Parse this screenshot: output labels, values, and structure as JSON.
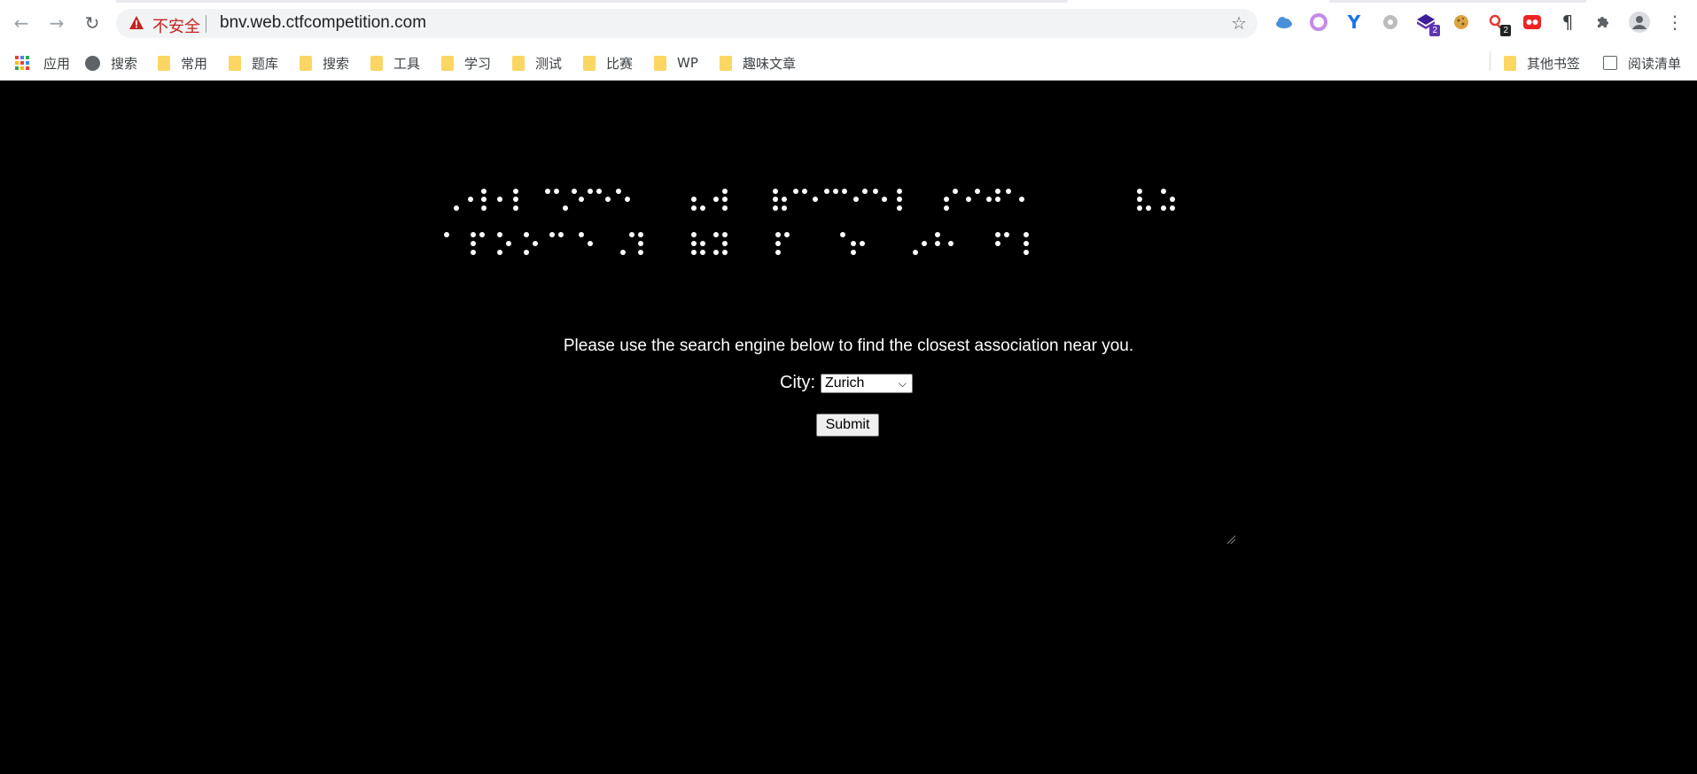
{
  "browser": {
    "url": "bnv.web.ctfcompetition.com",
    "security_label": "不安全",
    "extensions": [
      {
        "name": "cloud-icon"
      },
      {
        "name": "ring-icon"
      },
      {
        "name": "y-logo-icon"
      },
      {
        "name": "gear-ball-icon"
      },
      {
        "name": "hexagon-icon",
        "badge": "2"
      },
      {
        "name": "cookie-icon"
      },
      {
        "name": "ribbon-icon",
        "badge": "2"
      },
      {
        "name": "red-eyes-icon"
      },
      {
        "name": "pilcrow-icon"
      },
      {
        "name": "puzzle-icon"
      },
      {
        "name": "profile-icon"
      },
      {
        "name": "more-vertical-icon"
      }
    ]
  },
  "bookmarks": {
    "apps": "应用",
    "search_link": "搜索",
    "folders": [
      "常用",
      "题库",
      "搜索",
      "工具",
      "学习",
      "测试",
      "比赛",
      "WP",
      "趣味文章"
    ],
    "other": "其他书签",
    "reading_list": "阅读清单"
  },
  "page": {
    "intro": "Please use the search engine below to find the closest association near you.",
    "city_label": "City:",
    "city_selected": "Zurich",
    "submit_label": "Submit"
  },
  "colors": {
    "page_bg": "#000000",
    "text": "#ffffff",
    "insecure": "#c5221f"
  }
}
